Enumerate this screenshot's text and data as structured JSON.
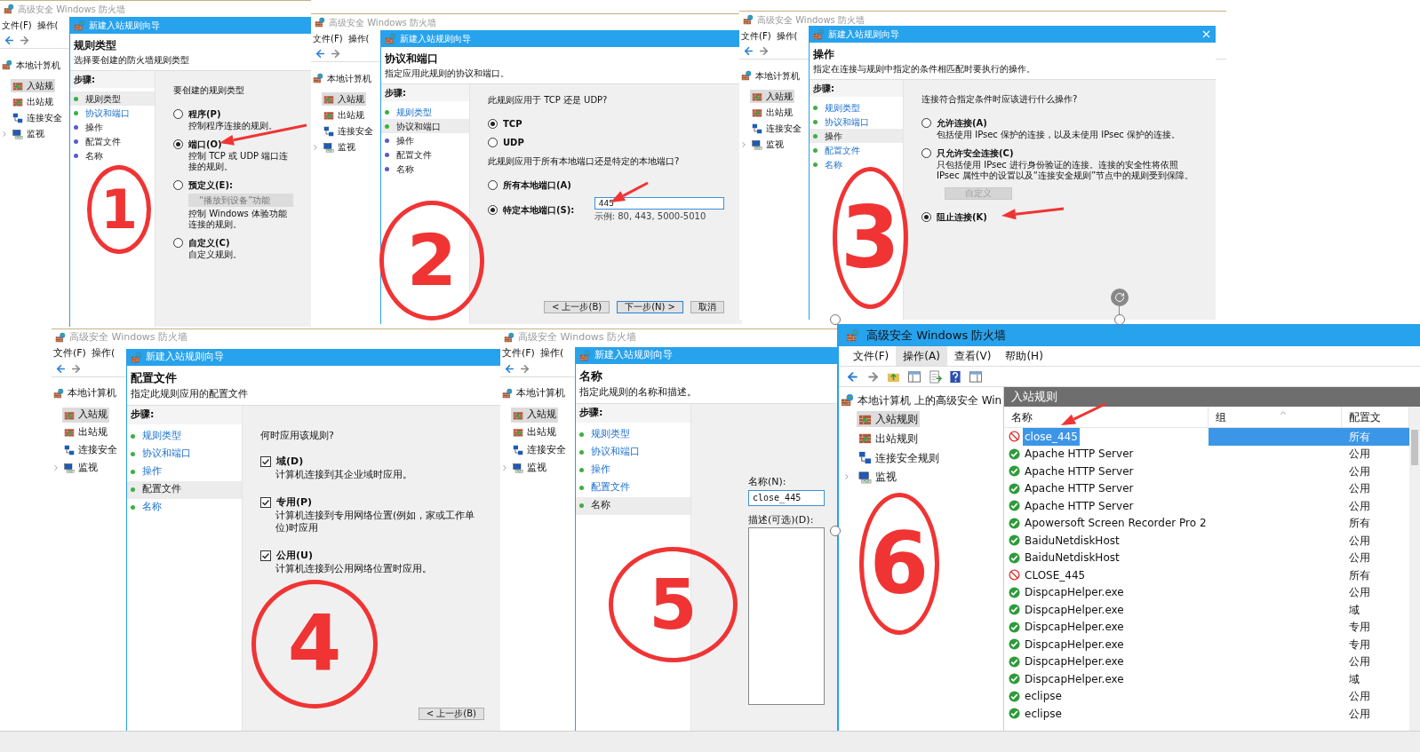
{
  "wizard_panels": [
    {
      "annotation": "1",
      "app_title": "高级安全 Windows 防火墙",
      "menu": [
        "文件(F)",
        "操作("
      ],
      "tree": {
        "label": "本地计算机",
        "children": [
          {
            "label": "入站规",
            "selected": true,
            "has_children": false
          },
          {
            "label": "出站规",
            "selected": false,
            "has_children": false
          },
          {
            "label": "连接安全",
            "selected": false,
            "has_children": false
          },
          {
            "label": "监视",
            "selected": false,
            "has_children": true
          }
        ]
      },
      "wizard_title": "新建入站规则向导",
      "closable": false,
      "heading": "规则类型",
      "subtitle": "选择要创建的防火墙规则类型",
      "steps_label": "步骤:",
      "steps": [
        {
          "label": "规则类型",
          "selected": true,
          "reachable": true
        },
        {
          "label": "协议和端口",
          "selected": false,
          "reachable": true
        },
        {
          "label": "操作",
          "selected": false,
          "reachable": false
        },
        {
          "label": "配置文件",
          "selected": false,
          "reachable": false
        },
        {
          "label": "名称",
          "selected": false,
          "reachable": false
        }
      ],
      "items": [
        {
          "kind": "prompt",
          "text": "要创建的规则类型"
        },
        {
          "kind": "radio",
          "label": "程序(P)",
          "desc": "控制程序连接的规则。",
          "selected": false
        },
        {
          "kind": "radio",
          "label": "端口(O)",
          "desc": "控制 TCP 或 UDP 端口连接的规则。",
          "selected": true
        },
        {
          "kind": "radio",
          "label": "预定义(E):",
          "select": "“播放到设备”功能",
          "desc": "控制 Windows 体验功能连接的规则。",
          "selected": false
        },
        {
          "kind": "radio",
          "label": "自定义(C)",
          "desc": "自定义规则。",
          "selected": false
        }
      ]
    },
    {
      "annotation": "2",
      "app_title": "高级安全 Windows 防火墙",
      "menu": [
        "文件(F)",
        "操作("
      ],
      "tree": {
        "label": "本地计算机",
        "children": [
          {
            "label": "入站规",
            "selected": true,
            "has_children": false
          },
          {
            "label": "出站规",
            "selected": false,
            "has_children": false
          },
          {
            "label": "连接安全",
            "selected": false,
            "has_children": false
          },
          {
            "label": "监视",
            "selected": false,
            "has_children": true
          }
        ]
      },
      "wizard_title": "新建入站规则向导",
      "closable": false,
      "heading": "协议和端口",
      "subtitle": "指定应用此规则的协议和端口。",
      "steps_label": "步骤:",
      "steps": [
        {
          "label": "规则类型",
          "selected": false,
          "reachable": true
        },
        {
          "label": "协议和端口",
          "selected": true,
          "reachable": true
        },
        {
          "label": "操作",
          "selected": false,
          "reachable": false
        },
        {
          "label": "配置文件",
          "selected": false,
          "reachable": false
        },
        {
          "label": "名称",
          "selected": false,
          "reachable": false
        }
      ],
      "items": [
        {
          "kind": "prompt",
          "text": "此规则应用于 TCP 还是 UDP?"
        },
        {
          "kind": "radio",
          "label": "TCP",
          "selected": true
        },
        {
          "kind": "radio",
          "label": "UDP",
          "selected": false
        },
        {
          "kind": "prompt",
          "text": "此规则应用于所有本地端口还是特定的本地端口?"
        },
        {
          "kind": "radio",
          "label": "所有本地端口(A)",
          "selected": false
        },
        {
          "kind": "radio",
          "label": "特定本地端口(S):",
          "input": "445",
          "hint": "示例: 80, 443, 5000-5010",
          "selected": true
        }
      ],
      "buttons": [
        {
          "label": "< 上一步(B)",
          "default": false
        },
        {
          "label": "下一步(N) >",
          "default": true
        },
        {
          "label": "取消",
          "default": false
        }
      ]
    },
    {
      "annotation": "3",
      "app_title": "高级安全 Windows 防火墙",
      "menu": [
        "文件(F)",
        "操作("
      ],
      "tree": {
        "label": "本地计算机",
        "children": [
          {
            "label": "入站规",
            "selected": true,
            "has_children": false
          },
          {
            "label": "出站规",
            "selected": false,
            "has_children": false
          },
          {
            "label": "连接安全",
            "selected": false,
            "has_children": false
          },
          {
            "label": "监视",
            "selected": false,
            "has_children": true
          }
        ]
      },
      "wizard_title": "新建入站规则向导",
      "closable": true,
      "heading": "操作",
      "subtitle": "指定在连接与规则中指定的条件相匹配时要执行的操作。",
      "steps_label": "步骤:",
      "steps": [
        {
          "label": "规则类型",
          "selected": false,
          "reachable": true
        },
        {
          "label": "协议和端口",
          "selected": false,
          "reachable": true
        },
        {
          "label": "操作",
          "selected": true,
          "reachable": true
        },
        {
          "label": "配置文件",
          "selected": false,
          "reachable": true
        },
        {
          "label": "名称",
          "selected": false,
          "reachable": true
        }
      ],
      "items": [
        {
          "kind": "prompt",
          "text": "连接符合指定条件时应该进行什么操作?"
        },
        {
          "kind": "radio",
          "label": "允许连接(A)",
          "desc": "包括使用 IPsec 保护的连接，以及未使用 IPsec 保护的连接。",
          "selected": false
        },
        {
          "kind": "radio",
          "label": "只允许安全连接(C)",
          "desc": "只包括使用 IPsec 进行身份验证的连接。连接的安全性将依照 IPsec 属性中的设置以及“连接安全规则”节点中的规则受到保障。",
          "selected": false
        },
        {
          "kind": "button",
          "label": "自定义",
          "disabled": true
        },
        {
          "kind": "radio",
          "label": "阻止连接(K)",
          "selected": true
        }
      ]
    },
    {
      "annotation": "4",
      "app_title": "高级安全 Windows 防火墙",
      "menu": [
        "文件(F)",
        "操作("
      ],
      "tree": {
        "label": "本地计算机",
        "children": [
          {
            "label": "入站规",
            "selected": true,
            "has_children": false
          },
          {
            "label": "出站规",
            "selected": false,
            "has_children": false
          },
          {
            "label": "连接安全",
            "selected": false,
            "has_children": false
          },
          {
            "label": "监视",
            "selected": false,
            "has_children": true
          }
        ]
      },
      "wizard_title": "新建入站规则向导",
      "closable": false,
      "heading": "配置文件",
      "subtitle": "指定此规则应用的配置文件",
      "steps_label": "步骤:",
      "steps": [
        {
          "label": "规则类型",
          "selected": false,
          "reachable": true
        },
        {
          "label": "协议和端口",
          "selected": false,
          "reachable": true
        },
        {
          "label": "操作",
          "selected": false,
          "reachable": true
        },
        {
          "label": "配置文件",
          "selected": true,
          "reachable": true
        },
        {
          "label": "名称",
          "selected": false,
          "reachable": true
        }
      ],
      "items": [
        {
          "kind": "prompt",
          "text": "何时应用该规则?"
        },
        {
          "kind": "checkbox",
          "label": "域(D)",
          "desc": "计算机连接到其企业域时应用。",
          "checked": true
        },
        {
          "kind": "checkbox",
          "label": "专用(P)",
          "desc": "计算机连接到专用网络位置(例如，家或工作单位)时应用",
          "checked": true
        },
        {
          "kind": "checkbox",
          "label": "公用(U)",
          "desc": "计算机连接到公用网络位置时应用。",
          "checked": true
        }
      ],
      "buttons": [
        {
          "label": "< 上一步(B)",
          "default": false
        }
      ]
    },
    {
      "annotation": "5",
      "app_title": "高级安全 Windows 防火墙",
      "menu": [
        "文件(F)",
        "操作("
      ],
      "tree": {
        "label": "本地计算机",
        "children": [
          {
            "label": "入站规",
            "selected": true,
            "has_children": false
          },
          {
            "label": "出站规",
            "selected": false,
            "has_children": false
          },
          {
            "label": "连接安全",
            "selected": false,
            "has_children": false
          },
          {
            "label": "监视",
            "selected": false,
            "has_children": true
          }
        ]
      },
      "wizard_title": "新建入站规则向导",
      "closable": false,
      "heading": "名称",
      "subtitle": "指定此规则的名称和描述。",
      "steps_label": "步骤:",
      "steps": [
        {
          "label": "规则类型",
          "selected": false,
          "reachable": true
        },
        {
          "label": "协议和端口",
          "selected": false,
          "reachable": true
        },
        {
          "label": "操作",
          "selected": false,
          "reachable": true
        },
        {
          "label": "配置文件",
          "selected": false,
          "reachable": true
        },
        {
          "label": "名称",
          "selected": true,
          "reachable": true
        }
      ],
      "items": [
        {
          "kind": "field",
          "label": "名称(N):",
          "value": "close_445"
        },
        {
          "kind": "textarea",
          "label": "描述(可选)(D):"
        }
      ]
    }
  ],
  "main_window": {
    "annotation": "6",
    "title": "高级安全 Windows 防火墙",
    "menu": [
      {
        "label": "文件(F)",
        "selected": false
      },
      {
        "label": "操作(A)",
        "selected": true
      },
      {
        "label": "查看(V)",
        "selected": false
      },
      {
        "label": "帮助(H)",
        "selected": false
      }
    ],
    "tree": {
      "label": "本地计算机 上的高级安全 Win",
      "children": [
        {
          "label": "入站规则",
          "selected": true,
          "has_children": false
        },
        {
          "label": "出站规则",
          "selected": false,
          "has_children": false
        },
        {
          "label": "连接安全规则",
          "selected": false,
          "has_children": false
        },
        {
          "label": "监视",
          "selected": false,
          "has_children": true
        }
      ]
    },
    "pane_title": "入站规则",
    "columns": [
      "名称",
      "组",
      "配置文"
    ],
    "rows": [
      {
        "name": "close_445",
        "profile": "所有",
        "kind": "block",
        "selected": true
      },
      {
        "name": "Apache HTTP Server",
        "profile": "公用",
        "kind": "allow",
        "selected": false
      },
      {
        "name": "Apache HTTP Server",
        "profile": "公用",
        "kind": "allow",
        "selected": false
      },
      {
        "name": "Apache HTTP Server",
        "profile": "公用",
        "kind": "allow",
        "selected": false
      },
      {
        "name": "Apache HTTP Server",
        "profile": "公用",
        "kind": "allow",
        "selected": false
      },
      {
        "name": "Apowersoft Screen Recorder Pro 2",
        "profile": "所有",
        "kind": "allow",
        "selected": false
      },
      {
        "name": "BaiduNetdiskHost",
        "profile": "公用",
        "kind": "allow",
        "selected": false
      },
      {
        "name": "BaiduNetdiskHost",
        "profile": "公用",
        "kind": "allow",
        "selected": false
      },
      {
        "name": "CLOSE_445",
        "profile": "所有",
        "kind": "block",
        "selected": false
      },
      {
        "name": "DispcapHelper.exe",
        "profile": "公用",
        "kind": "allow",
        "selected": false
      },
      {
        "name": "DispcapHelper.exe",
        "profile": "域",
        "kind": "allow",
        "selected": false
      },
      {
        "name": "DispcapHelper.exe",
        "profile": "专用",
        "kind": "allow",
        "selected": false
      },
      {
        "name": "DispcapHelper.exe",
        "profile": "专用",
        "kind": "allow",
        "selected": false
      },
      {
        "name": "DispcapHelper.exe",
        "profile": "公用",
        "kind": "allow",
        "selected": false
      },
      {
        "name": "DispcapHelper.exe",
        "profile": "域",
        "kind": "allow",
        "selected": false
      },
      {
        "name": "eclipse",
        "profile": "公用",
        "kind": "allow",
        "selected": false
      },
      {
        "name": "eclipse",
        "profile": "公用",
        "kind": "allow",
        "selected": false
      }
    ]
  }
}
